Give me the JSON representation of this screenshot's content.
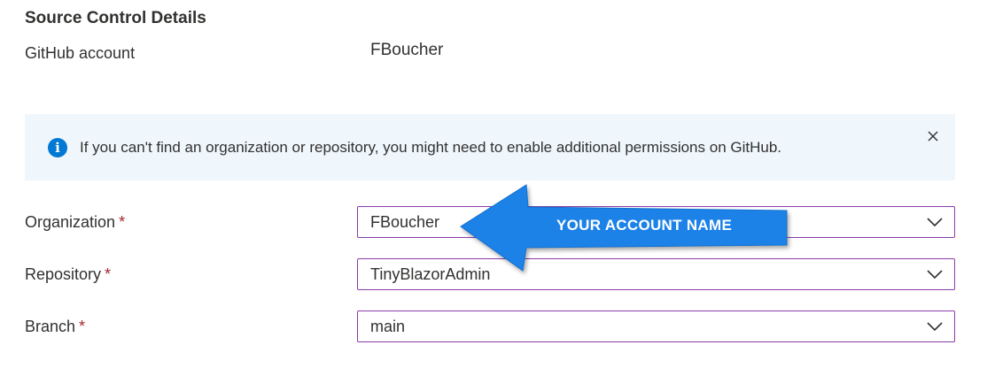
{
  "section": {
    "title": "Source Control Details"
  },
  "github_account": {
    "label": "GitHub account",
    "value": "FBoucher"
  },
  "info_bar": {
    "message": "If you can't find an organization or repository, you might need to enable additional permissions on GitHub.",
    "icon": "info-icon",
    "close_icon": "close-icon"
  },
  "fields": {
    "organization": {
      "label": "Organization",
      "required_marker": "*",
      "value": "FBoucher"
    },
    "repository": {
      "label": "Repository",
      "required_marker": "*",
      "value": "TinyBlazorAdmin"
    },
    "branch": {
      "label": "Branch",
      "required_marker": "*",
      "value": "main"
    }
  },
  "annotation": {
    "text": "YOUR ACCOUNT NAME",
    "color": "#1a82e8"
  },
  "colors": {
    "info_bar_bg": "#eff6fc",
    "info_icon": "#0078d4",
    "dropdown_border": "#8a3da8",
    "required": "#a4262c",
    "text": "#323130"
  }
}
